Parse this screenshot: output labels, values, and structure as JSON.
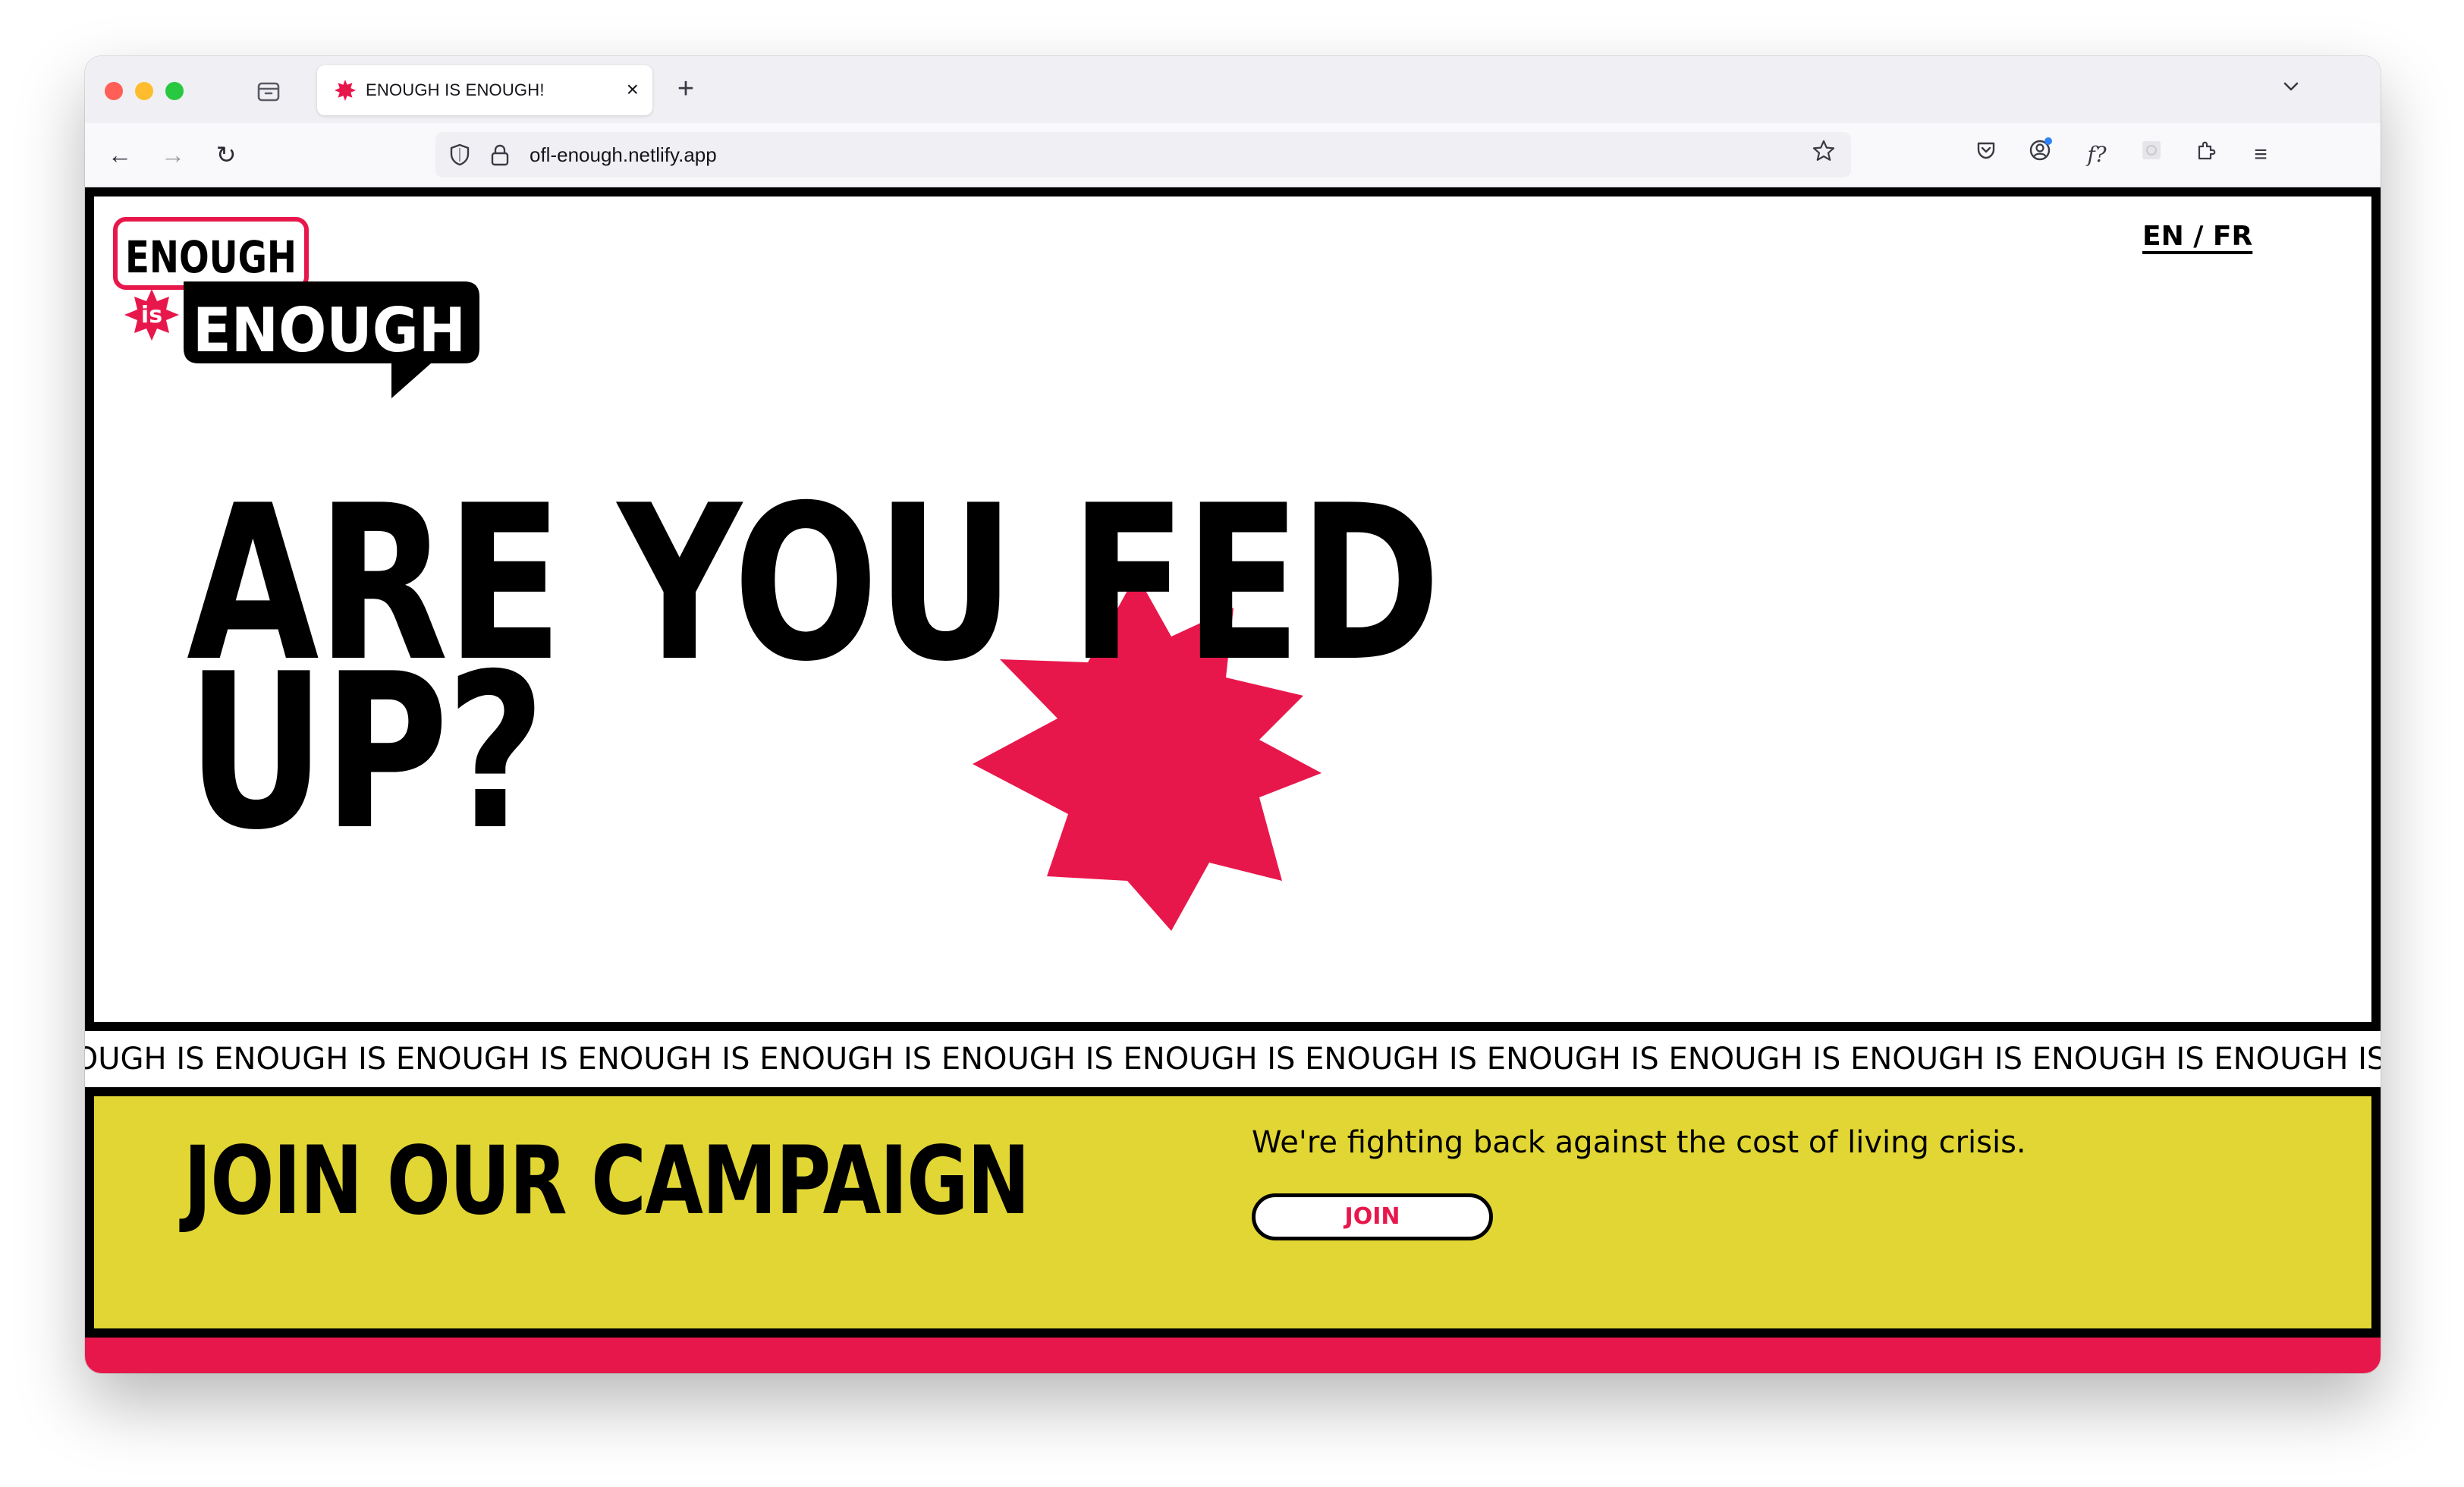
{
  "browser": {
    "tab": {
      "title": "ENOUGH IS ENOUGH!",
      "close_glyph": "×",
      "favicon": "starburst-icon"
    },
    "new_tab_glyph": "+",
    "tabs_dropdown_glyph": "⌄",
    "nav": {
      "back_glyph": "←",
      "forward_glyph": "→",
      "reload_glyph": "↻"
    },
    "url": "ofl-enough.netlify.app",
    "toolbar_icons": [
      "pocket-icon",
      "account-icon",
      "font-icon",
      "extension-placeholder-icon",
      "extensions-icon",
      "menu-icon"
    ],
    "font_icon_text": "f?",
    "menu_glyph": "≡"
  },
  "page": {
    "logo": {
      "top_word": "ENOUGH",
      "badge_word": "is",
      "bottom_word": "ENOUGH"
    },
    "lang_switch": "EN / FR",
    "headline": {
      "line1": "ARE YOU FED",
      "line2": "UP?"
    },
    "ticker": "IOUGH IS ENOUGH IS ENOUGH IS ENOUGH IS ENOUGH IS ENOUGH IS ENOUGH IS ENOUGH IS ENOUGH IS ENOUGH IS ENOUGH IS ENOUGH IS ENOUGH IS ENOUGH IS ENOUGH",
    "campaign": {
      "title": "JOIN OUR CAMPAIGN",
      "text": "We're fighting back against the cost of living crisis.",
      "button": "JOIN"
    },
    "colors": {
      "accent_red": "#e8174b",
      "campaign_yellow": "#e1d633",
      "ink": "#000000"
    }
  }
}
